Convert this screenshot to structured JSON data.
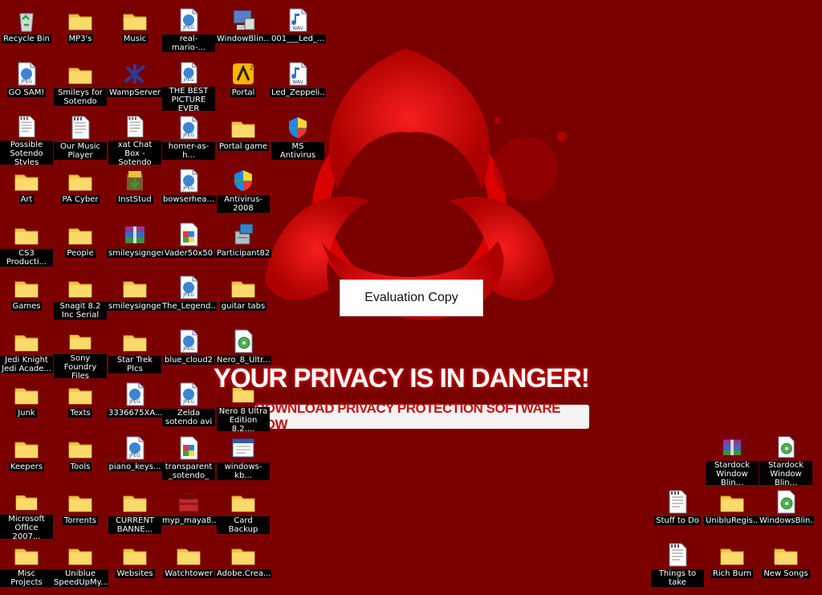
{
  "wallpaper": {
    "headline": "YOUR PRIVACY IS IN DANGER!",
    "cta": "DOWNLOAD PRIVACY PROTECTION SOFTWARE NOW",
    "watermark": "Evaluation Copy"
  },
  "colors": {
    "background": "#7a0000",
    "biohazard": "#e00000",
    "label_bg": "#000000"
  },
  "icons": [
    {
      "label": "Recycle Bin",
      "icon": "recycle-bin-icon"
    },
    {
      "label": "MP3's",
      "icon": "folder-icon"
    },
    {
      "label": "Music",
      "icon": "folder-icon"
    },
    {
      "label": "real-mario-...",
      "icon": "jpeg-file-icon"
    },
    {
      "label": "WindowBlin...",
      "icon": "computer-icon"
    },
    {
      "label": "001___Led_...",
      "icon": "wav-file-icon"
    },
    {
      "label": "GO SAM!",
      "icon": "jpeg-file-icon"
    },
    {
      "label": "Smileys for Sotendo",
      "icon": "folder-icon"
    },
    {
      "label": "WampServer",
      "icon": "wampserver-icon"
    },
    {
      "label": "THE BEST PICTURE EVER",
      "icon": "jpeg-file-icon"
    },
    {
      "label": "Portal",
      "icon": "portal-icon"
    },
    {
      "label": "Led_Zeppeli...",
      "icon": "wav-file-icon"
    },
    {
      "label": "Possible Sotendo Styles",
      "icon": "text-file-icon"
    },
    {
      "label": "Our Music Player",
      "icon": "text-file-icon"
    },
    {
      "label": "xat Chat Box - Sotendo",
      "icon": "text-file-icon"
    },
    {
      "label": "homer-as-h...",
      "icon": "jpeg-file-icon"
    },
    {
      "label": "Portal game",
      "icon": "folder-icon"
    },
    {
      "label": "MS Antivirus",
      "icon": "shield-icon"
    },
    {
      "label": "Art",
      "icon": "folder-icon"
    },
    {
      "label": "PA Cyber",
      "icon": "folder-icon"
    },
    {
      "label": "InstStud",
      "icon": "installer-icon"
    },
    {
      "label": "bowserhea...",
      "icon": "jpeg-file-icon"
    },
    {
      "label": "Antivirus-2008",
      "icon": "shield-icon"
    },
    {
      "label": "CS3 Producti...",
      "icon": "folder-icon"
    },
    {
      "label": "People",
      "icon": "folder-icon"
    },
    {
      "label": "smileysigngen",
      "icon": "archive-icon"
    },
    {
      "label": "Vader50x50",
      "icon": "image-file-icon"
    },
    {
      "label": "Participant82",
      "icon": "setup-icon"
    },
    {
      "label": "Games",
      "icon": "folder-icon"
    },
    {
      "label": "Snagit 8.2 Inc Serial",
      "icon": "folder-icon"
    },
    {
      "label": "smileysigngen",
      "icon": "folder-icon"
    },
    {
      "label": "The_Legend...",
      "icon": "jpeg-file-icon"
    },
    {
      "label": "guitar tabs",
      "icon": "folder-icon"
    },
    {
      "label": "Jedi Knight Jedi Acade...",
      "icon": "folder-icon"
    },
    {
      "label": "Sony Foundry Files",
      "icon": "folder-icon"
    },
    {
      "label": "Star Trek PIcs",
      "icon": "folder-icon"
    },
    {
      "label": "blue_cloud2",
      "icon": "jpeg-file-icon"
    },
    {
      "label": "Nero_8_Ultr...",
      "icon": "nero-file-icon"
    },
    {
      "label": "Junk",
      "icon": "folder-icon"
    },
    {
      "label": "Texts",
      "icon": "folder-icon"
    },
    {
      "label": "3336675XA...",
      "icon": "jpeg-file-icon"
    },
    {
      "label": "Zelda sotendo avi",
      "icon": "jpeg-file-icon"
    },
    {
      "label": "Nero 8 Ultra Edition 8.2....",
      "icon": "folder-icon"
    },
    {
      "label": "Keepers",
      "icon": "folder-icon"
    },
    {
      "label": "Tools",
      "icon": "folder-icon"
    },
    {
      "label": "piano_keys...",
      "icon": "jpeg-file-icon"
    },
    {
      "label": "transparent _sotendo_",
      "icon": "image-file-icon"
    },
    {
      "label": "windows-kb...",
      "icon": "window-icon"
    },
    {
      "label": "Microsoft Office 2007...",
      "icon": "folder-icon"
    },
    {
      "label": "Torrents",
      "icon": "folder-icon"
    },
    {
      "label": "CURRENT BANNE...",
      "icon": "folder-icon"
    },
    {
      "label": "myp_maya8...",
      "icon": "toolbox-icon"
    },
    {
      "label": "Card Backup",
      "icon": "folder-icon"
    },
    {
      "label": "Misc Projects",
      "icon": "folder-icon"
    },
    {
      "label": "Uniblue SpeedUpMy...",
      "icon": "folder-icon"
    },
    {
      "label": "Websites",
      "icon": "folder-icon"
    },
    {
      "label": "Watchtower",
      "icon": "folder-icon"
    },
    {
      "label": "Adobe.Crea...",
      "icon": "folder-icon"
    },
    {
      "label": "Stardock Window Blin...",
      "icon": "archive-icon"
    },
    {
      "label": "Stardock Window Blin...",
      "icon": "nero-file-icon"
    },
    {
      "label": "Stuff to Do",
      "icon": "text-file-icon"
    },
    {
      "label": "UnibluRegis...",
      "icon": "folder-icon"
    },
    {
      "label": "WindowsBlin...",
      "icon": "nero-file-icon"
    },
    {
      "label": "Things to take",
      "icon": "text-file-icon"
    },
    {
      "label": "Rich Burn",
      "icon": "folder-icon"
    },
    {
      "label": "New Songs",
      "icon": "folder-icon"
    }
  ]
}
